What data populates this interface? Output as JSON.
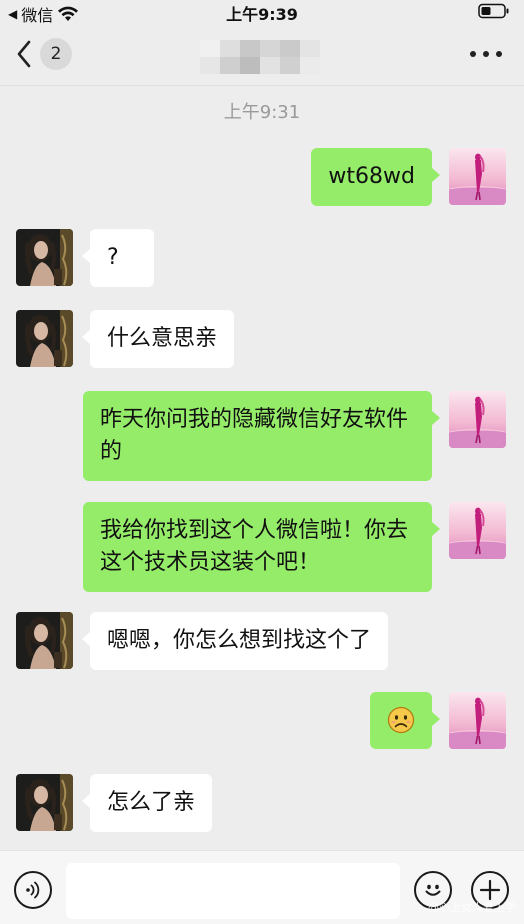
{
  "status_bar": {
    "carrier": "微信",
    "time": "上午9:39"
  },
  "nav": {
    "unread_count": "2"
  },
  "chat": {
    "timestamp": "上午9:31",
    "messages": [
      {
        "from": "me",
        "text": "wt68wd"
      },
      {
        "from": "contact",
        "text": "?"
      },
      {
        "from": "contact",
        "text": "什么意思亲"
      },
      {
        "from": "me",
        "text": "昨天你问我的隐藏微信好友软件的"
      },
      {
        "from": "me",
        "text": "我给你找到这个人微信啦！你去这个技术员这装个吧！"
      },
      {
        "from": "contact",
        "text": "嗯嗯，你怎么想到找这个了"
      },
      {
        "from": "me",
        "emoji": "🙁",
        "icon": "frown-emoji"
      },
      {
        "from": "contact",
        "text": "怎么了亲"
      }
    ]
  },
  "input_bar": {
    "message_value": "",
    "watermark": "@心上女人爱上学"
  },
  "colors": {
    "background": "#ededed",
    "outgoing_bubble": "#95ec69",
    "incoming_bubble": "#ffffff",
    "timestamp_text": "#9a9a9a"
  }
}
